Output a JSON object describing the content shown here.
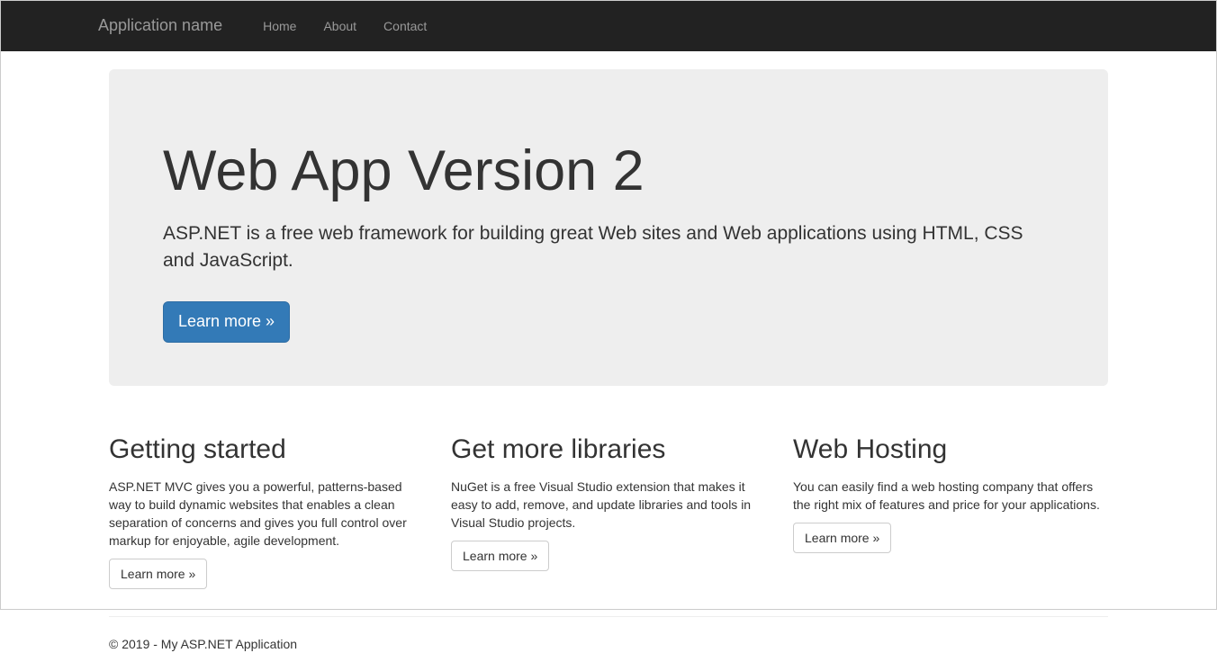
{
  "navbar": {
    "brand": "Application name",
    "links": [
      "Home",
      "About",
      "Contact"
    ]
  },
  "jumbotron": {
    "title": "Web App Version 2",
    "lead": "ASP.NET is a free web framework for building great Web sites and Web applications using HTML, CSS and JavaScript.",
    "button": "Learn more »"
  },
  "columns": [
    {
      "heading": "Getting started",
      "body": "ASP.NET MVC gives you a powerful, patterns-based way to build dynamic websites that enables a clean separation of concerns and gives you full control over markup for enjoyable, agile development.",
      "button": "Learn more »"
    },
    {
      "heading": "Get more libraries",
      "body": "NuGet is a free Visual Studio extension that makes it easy to add, remove, and update libraries and tools in Visual Studio projects.",
      "button": "Learn more »"
    },
    {
      "heading": "Web Hosting",
      "body": "You can easily find a web hosting company that offers the right mix of features and price for your applications.",
      "button": "Learn more »"
    }
  ],
  "footer": {
    "text": "© 2019 - My ASP.NET Application"
  }
}
